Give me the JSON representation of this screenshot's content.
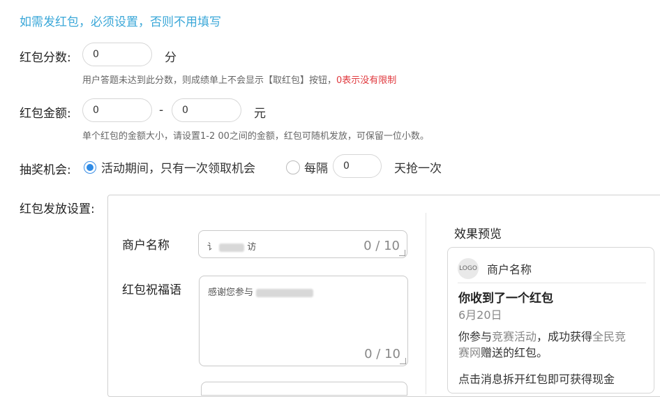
{
  "notice": "如需发红包，必须设置，否则不用填写",
  "score": {
    "label": "红包分数:",
    "value": "0",
    "unit": "分",
    "hint_main": "用户答题未达到此分数，则成绩单上不会显示【取红包】按钮，",
    "hint_red": "0表示没有限制"
  },
  "amount": {
    "label": "红包金额:",
    "min": "0",
    "separator": "-",
    "max": "0",
    "unit": "元",
    "hint": "单个红包的金额大小，请设置1-2 00之间的金额，红包可随机发放，可保留一位小数。"
  },
  "lottery": {
    "label": "抽奖机会:",
    "option1": "活动期间，只有一次领取机会",
    "option2": "每隔",
    "days": "0",
    "option2_suffix": "天抢一次"
  },
  "distribution": {
    "label": "红包发放设置:",
    "merchant_label": "商户名称",
    "merchant_value_a": "讠",
    "merchant_value_b": "访",
    "merchant_count": "0 / 10",
    "blessing_label": "红包祝福语",
    "blessing_value": "感谢您参与",
    "blessing_count": "0 / 10"
  },
  "preview": {
    "title": "效果预览",
    "logo": "LOGO",
    "merchant": "商户名称",
    "heading": "你收到了一个红包",
    "date": "6月20日",
    "body_1": "你参与",
    "body_link1": "竞赛活动",
    "body_2": "，成功获得",
    "body_link2a": "全民竞",
    "body_link2b": "赛网",
    "body_3": "赠送的红包。",
    "tail": "点击消息拆开红包即可获得现金"
  }
}
